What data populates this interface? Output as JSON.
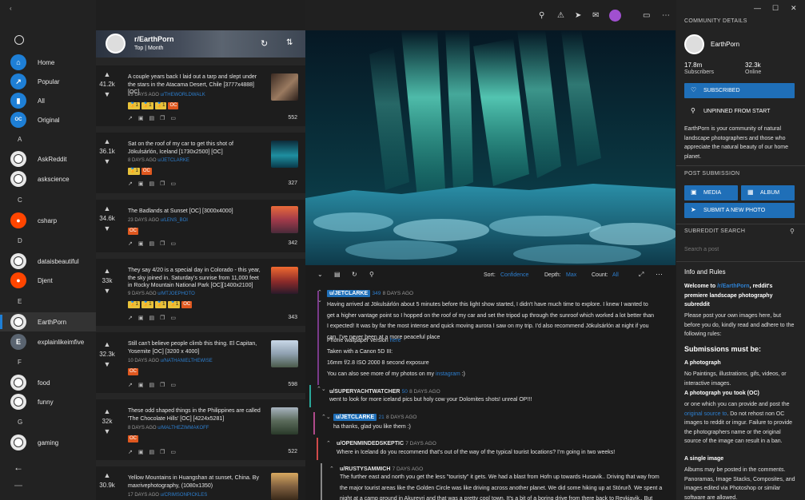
{
  "nav": {
    "items": [
      {
        "label": "Home",
        "initial": "⌂",
        "color": "#1e7fd6"
      },
      {
        "label": "Popular",
        "initial": "↗",
        "color": "#1e7fd6"
      },
      {
        "label": "All",
        "initial": "▮",
        "color": "#1e7fd6"
      },
      {
        "label": "Original",
        "initial": "OC",
        "color": "#1e7fd6"
      }
    ],
    "letters": [
      "A",
      "C",
      "D",
      "E",
      "F",
      "G"
    ],
    "subs": [
      {
        "label": "AskReddit"
      },
      {
        "label": "askscience"
      },
      {
        "label": "csharp"
      },
      {
        "label": "dataisbeautiful"
      },
      {
        "label": "Djent"
      },
      {
        "label": "EarthPorn"
      },
      {
        "label": "explainlikeimfive",
        "initial": "E"
      },
      {
        "label": "food"
      },
      {
        "label": "funny"
      },
      {
        "label": "gaming"
      }
    ]
  },
  "list_header": {
    "sub": "r/EarthPorn",
    "sort": "Top | Month"
  },
  "posts": [
    {
      "votes": "41.2k",
      "title": "A couple years back I laid out a tarp and slept under the stars in the Atacama Desert, Chile [3777x4888] [OC]",
      "age": "29 DAYS AGO",
      "author": "u/THEWORLDWALK",
      "badges": [
        "1",
        "1",
        "1"
      ],
      "oc": "OC",
      "comments": "552"
    },
    {
      "votes": "36.1k",
      "title": "Sat on the roof of my car to get this shot of Jökulsárlón, Iceland [1730x2500] [OC]",
      "age": "8 DAYS AGO",
      "author": "u/JETCLARKE",
      "badges": [
        "1"
      ],
      "oc": "OC",
      "comments": "327"
    },
    {
      "votes": "34.6k",
      "title": "The Badlands at Sunset [OC] [3000x4000]",
      "age": "23 DAYS AGO",
      "author": "u/LENS_BOI",
      "badges": [],
      "oc": "OC",
      "comments": "342"
    },
    {
      "votes": "33k",
      "title": "They say 4/20 is a special day in Colorado - this year, the sky joined in. Saturday's sunrise from 11,000 feet in Rocky Mountain National Park [OC][1400x2100]",
      "age": "9 DAYS AGO",
      "author": "u/MTJOEPHOTO",
      "badges": [
        "1",
        "1",
        "1",
        "1"
      ],
      "oc": "OC",
      "comments": "343"
    },
    {
      "votes": "32.3k",
      "title": "Still can't believe people climb this thing. El Capitan, Yosemite [OC] [3200 x 4000]",
      "age": "10 DAYS AGO",
      "author": "u/NATHANIELTHEWISE",
      "badges": [],
      "oc": "OC",
      "comments": "598"
    },
    {
      "votes": "32k",
      "title": "These odd shaped things in the Philippines are called 'The Chocolate Hills' [OC] [4224x5281]",
      "age": "8 DAYS AGO",
      "author": "u/MALTHEZIMMAKOFF",
      "badges": [],
      "oc": "OC",
      "comments": "522"
    },
    {
      "votes": "30.9k",
      "title": "Yellow Mountains in Huangshan at sunset, China. By maxrivephotography, (1080x1350)",
      "age": "17 DAYS AGO",
      "author": "u/CRIMSONPICKLES",
      "badges": [],
      "oc": "",
      "comments": ""
    }
  ],
  "comment_bar": {
    "sort_label": "Sort:",
    "sort_value": "Confidence",
    "depth_label": "Depth:",
    "depth_value": "Max",
    "count_label": "Count:",
    "count_value": "All"
  },
  "comments": [
    {
      "user": "u/JETCLARKE",
      "score": "349",
      "age": "8 DAYS AGO",
      "op": true,
      "lines": [
        "Having arrived at Jökulsárlón about 5 minutes before this light show started, I didn't have much time to explore. I knew I wanted to get a higher vantage point so I hopped on the roof of my car and set the tripod up through the sunroof which worked a lot better than I expected! It was by far the most intense and quick moving aurora I saw on my trip. I'd also recommend Jökulsárlón at night if you can, I've never been at a more peaceful place"
      ],
      "l2": "Phone wallpaper version ",
      "l2link": "here",
      "l3": "Taken with a Canon 5D III:",
      "l4": "16mm f/2.8 ISO 2000 8 second exposure",
      "l5": "You can also see more of my photos on my ",
      "l5link": "instagram",
      "l5end": " :)"
    },
    {
      "user": "u/SUPERYACHTWATCHER",
      "score": "50",
      "age": "8 DAYS AGO",
      "text": "went to look for more iceland pics but holy cow your Dolomites shots! unreal OP!!!"
    },
    {
      "user": "u/JETCLARKE",
      "score": "21",
      "age": "8 DAYS AGO",
      "op": true,
      "text": "ha thanks, glad you like them :)"
    },
    {
      "user": "u/OPENMINDEDSKEPTIC",
      "score": "",
      "age": "7 DAYS AGO",
      "text": "Where in Iceland do you recommend that's out of the way of the typical tourist locations? I'm going in two weeks!"
    },
    {
      "user": "u/RUSTYSAMMICH",
      "score": "",
      "age": "7 DAYS AGO",
      "text": "The further east and north you get the less \"touristy\" it gets. We had a blast from Hofn up towards Husavik.. Driving that way from the major tourist areas like the Golden Circle was like driving across another planet. We did some hiking up at Stórurð. We spent a night at a camp ground in Akureyri and that was a pretty cool town. It's a bit of a boring drive from there back to Reykjavik.. But"
    }
  ],
  "right": {
    "details_head": "COMMUNITY DETAILS",
    "sub_name": "EarthPorn",
    "subscribers_value": "17.8m",
    "subscribers_label": "Subscribers",
    "online_value": "32.3k",
    "online_label": "Online",
    "subscribed_btn": "SUBSCRIBED",
    "unpin_btn": "UNPINNED FROM START",
    "description": "EarthPorn is your community of natural landscape photographers and those who appreciate the natural beauty of our home planet.",
    "post_head": "POST SUBMISSION",
    "media_btn": "MEDIA",
    "album_btn": "ALBUM",
    "submit_btn": "SUBMIT A NEW PHOTO",
    "search_head": "SUBREDDIT SEARCH",
    "search_placeholder": "Search a post",
    "info_head": "Info and Rules",
    "welcome_a": "Welcome to ",
    "welcome_link": "/r/EarthPorn",
    "welcome_b": ", reddit's premiere landscape photography subreddit",
    "please": "Please post your own images here, but before you do, kindly read and adhere to the following rules:",
    "must_be": "Submissions must be:",
    "r1_head": "A photograph",
    "r1_text": "No Paintings, illustrations, gifs, videos, or interactive images.",
    "r2_head": "A photograph you took (OC)",
    "r2_a": "or one which you can provide and post the ",
    "r2_link": "original source to",
    "r2_b": ". Do not rehost non OC images to reddit or imgur. Failure to provide the photographers name or the original source of the image can result in a ban.",
    "r3_head": "A single image",
    "r3_text": "Albums may be posted in the comments. Panoramas, Image Stacks, Composites, and images edited via Photoshop or similar software are allowed."
  }
}
